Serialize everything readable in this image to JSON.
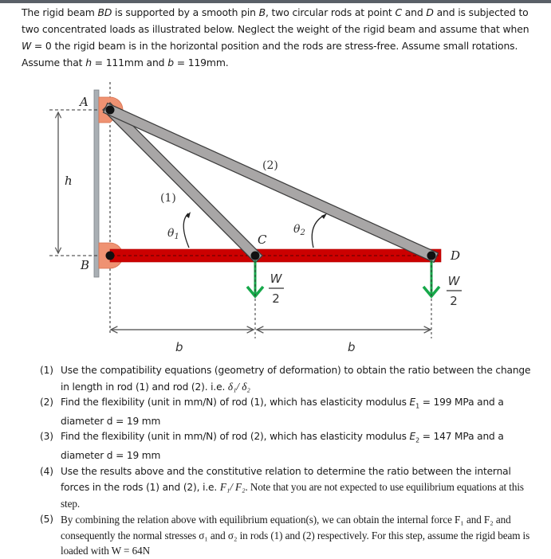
{
  "intro": {
    "p1": "The rigid beam ",
    "beam": "BD",
    "p2": " is supported by a smooth pin ",
    "pinB": "B",
    "p3": ", two circular rods at point ",
    "ptC": "C",
    "p4": " and ",
    "ptD": "D",
    "p5": " and is subjected to two concentrated loads as illustrated below. Neglect the weight of the rigid beam and assume that when ",
    "W": "W",
    "p6": " = 0 the rigid beam is in the horizontal position and the rods are stress-free. Assume small rotations. Assume that ",
    "h": "h",
    "p7": " = 111mm and ",
    "b": "b",
    "p8": " = 119mm."
  },
  "figure": {
    "label_A": "A",
    "label_B": "B",
    "label_C": "C",
    "label_D": "D",
    "label_h": "h",
    "label_rod1": "(1)",
    "label_rod2": "(2)",
    "label_theta1": "θ",
    "label_theta1_sub": "1",
    "label_theta2": "θ",
    "label_theta2_sub": "2",
    "load_num": "W",
    "load_den": "2",
    "dim_b1": "b",
    "dim_b2": "b",
    "colors": {
      "beam": "#cc0000",
      "rod": "#a6a4a4",
      "pin_support": "#ee9070",
      "load_arrow": "#16a84a",
      "wall": "#9aa0a6"
    }
  },
  "questions": [
    {
      "num": "(1)",
      "text": "Use the compatibility equations (geometry of deformation) to obtain the ratio between the change in length in rod (1) and rod (2). i.e. ",
      "math": "δ₁/ δ₂"
    },
    {
      "num": "(2)",
      "text_a": "Find the flexibility (unit in mm/N) of rod (1), which has elasticity modulus ",
      "E": "E",
      "E_sub": "1",
      "text_b": " = 199 MPa and a diameter d = 19 mm"
    },
    {
      "num": "(3)",
      "text_a": "Find the flexibility (unit in mm/N) of rod (2), which has elasticity modulus ",
      "E": "E",
      "E_sub": "2",
      "text_b": " = 147 MPa and a diameter d = 19 mm"
    },
    {
      "num": "(4)",
      "text_a": "Use the results above and the constitutive relation to determine the ratio between the internal forces in the rods (1) and (2), i.e. ",
      "math": "F₁/ F₂",
      "text_b": ". Note that you are not expected to use equilibrium equations at this step."
    },
    {
      "num": "(5)",
      "text": "By combining the relation above with equilibrium equation(s), we can obtain the internal force F₁ and F₂ and consequently the normal stresses σ₁ and σ₂ in rods (1) and (2) respectively. For this step, assume the rigid beam is loaded with W = 64N"
    }
  ]
}
